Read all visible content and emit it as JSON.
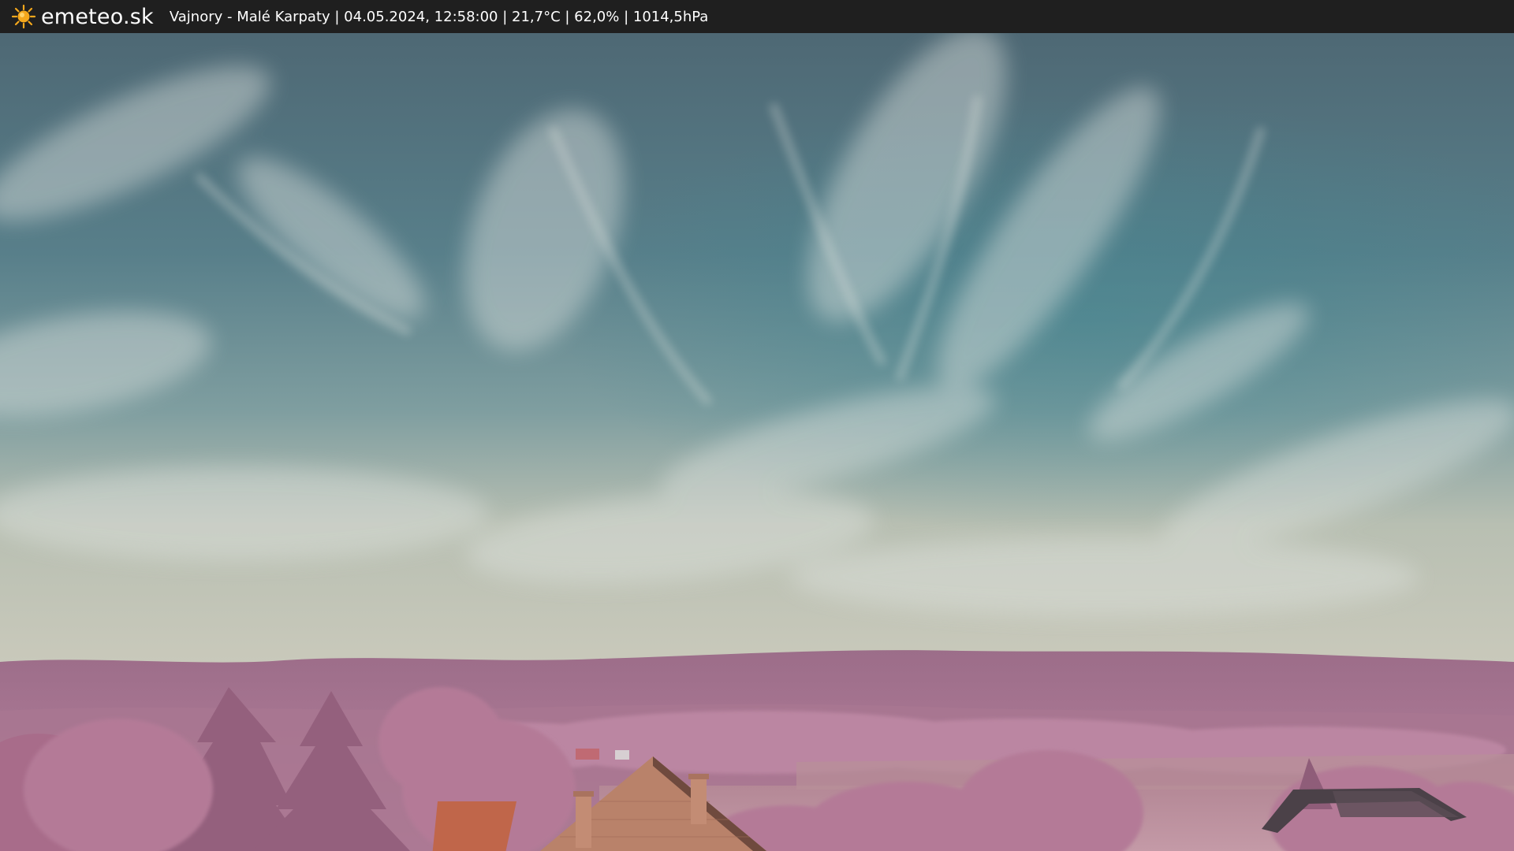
{
  "header": {
    "brand_icon": "sun-icon",
    "brand_name": "emeteo.sk",
    "caption": "Vajnory - Malé Karpaty | 04.05.2024, 12:58:00 | 21,7°C | 62,0% | 1014,5hPa"
  },
  "colors": {
    "bar_background": "#1f1f1f",
    "sun": "#f5a81c",
    "sky_top": "#4f6e7b",
    "sky_mid": "#5b8a94",
    "sky_horizon": "#c7c8ba",
    "hills": "#9a6a86",
    "foliage": "#b77a98",
    "roof": "#c0664a"
  }
}
